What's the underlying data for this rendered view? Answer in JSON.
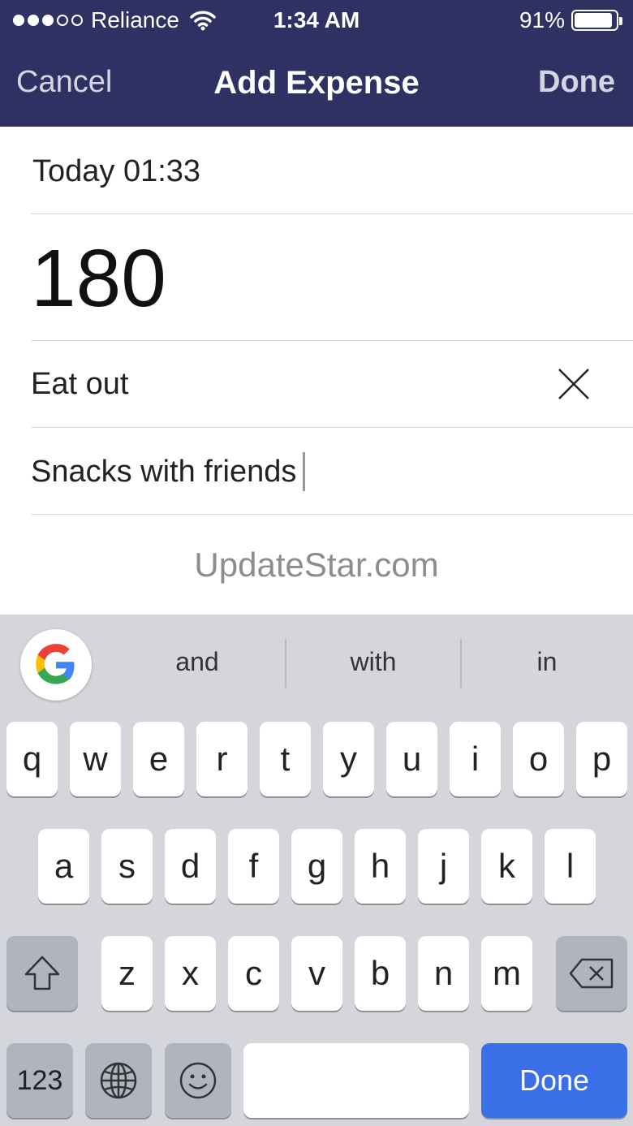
{
  "status_bar": {
    "carrier": "Reliance",
    "time": "1:34 AM",
    "battery": "91%",
    "battery_level": 0.91,
    "signal_bars_filled": 3,
    "signal_bars_total": 5
  },
  "nav": {
    "cancel": "Cancel",
    "title": "Add Expense",
    "done": "Done"
  },
  "form": {
    "date": "Today 01:33",
    "amount": "180",
    "category": "Eat out",
    "note": "Snacks with friends"
  },
  "watermark": "UpdateStar.com",
  "keyboard": {
    "suggestions": [
      "and",
      "with",
      "in"
    ],
    "row1": [
      "q",
      "w",
      "e",
      "r",
      "t",
      "y",
      "u",
      "i",
      "o",
      "p"
    ],
    "row2": [
      "a",
      "s",
      "d",
      "f",
      "g",
      "h",
      "j",
      "k",
      "l"
    ],
    "row3": [
      "z",
      "x",
      "c",
      "v",
      "b",
      "n",
      "m"
    ],
    "numbers_key": "123",
    "done_key": "Done",
    "icons": {
      "shift": "shift-icon",
      "delete": "backspace-icon",
      "globe": "globe-icon",
      "emoji": "emoji-icon",
      "google": "google-logo-icon"
    },
    "colors": {
      "background": "#d4d6dc",
      "done_key": "#3b6fe8"
    }
  },
  "colors": {
    "header": "#2f3163"
  }
}
